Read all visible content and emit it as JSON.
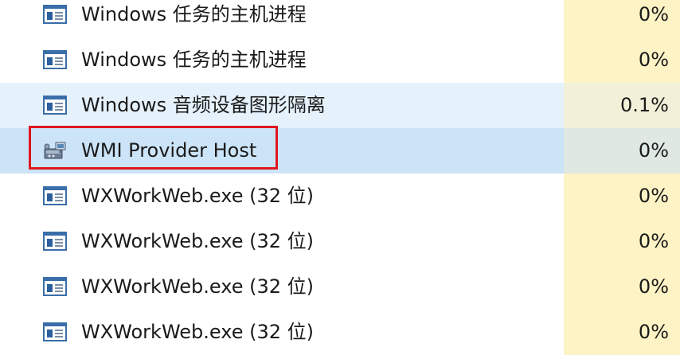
{
  "processes": [
    {
      "name": "Windows 任务的主机进程",
      "cpu": "0%",
      "icon": "app-window-icon",
      "state": "normal"
    },
    {
      "name": "Windows 任务的主机进程",
      "cpu": "0%",
      "icon": "app-window-icon",
      "state": "normal"
    },
    {
      "name": "Windows 音频设备图形隔离",
      "cpu": "0.1%",
      "icon": "app-window-icon",
      "state": "hover"
    },
    {
      "name": "WMI Provider Host",
      "cpu": "0%",
      "icon": "wmi-provider-icon",
      "state": "selected"
    },
    {
      "name": "WXWorkWeb.exe (32 位)",
      "cpu": "0%",
      "icon": "app-window-icon",
      "state": "normal"
    },
    {
      "name": "WXWorkWeb.exe (32 位)",
      "cpu": "0%",
      "icon": "app-window-icon",
      "state": "normal"
    },
    {
      "name": "WXWorkWeb.exe (32 位)",
      "cpu": "0%",
      "icon": "app-window-icon",
      "state": "normal"
    },
    {
      "name": "WXWorkWeb.exe (32 位)",
      "cpu": "0%",
      "icon": "app-window-icon",
      "state": "normal"
    }
  ],
  "colors": {
    "cpu_column": "#fdf3c5",
    "hover_row": "#e5f1fb",
    "selected_row": "#cce4f7",
    "highlight_box": "#e0161e"
  }
}
